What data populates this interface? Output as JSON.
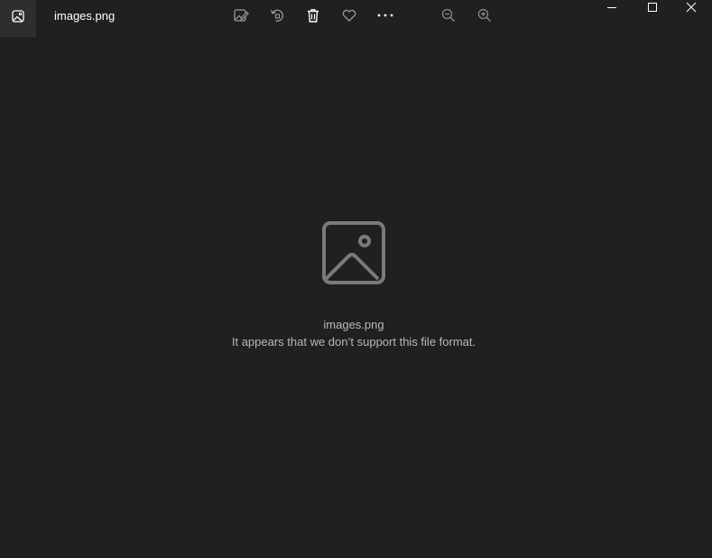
{
  "window": {
    "title": "images.png",
    "app_icon": "photo-app-icon"
  },
  "toolbar": {
    "items": [
      {
        "name": "edit-image-icon",
        "label": "Edit & Create"
      },
      {
        "name": "rotate-icon",
        "label": "Rotate"
      },
      {
        "name": "delete-icon",
        "label": "Delete"
      },
      {
        "name": "favorite-icon",
        "label": "Add to favorites"
      },
      {
        "name": "more-icon",
        "label": "See more"
      },
      {
        "name": "zoom-out-icon",
        "label": "Zoom out"
      },
      {
        "name": "zoom-in-icon",
        "label": "Zoom in"
      }
    ]
  },
  "caption_buttons": [
    "minimize-icon",
    "maximize-icon",
    "close-icon"
  ],
  "content": {
    "placeholder_icon": "image-placeholder-icon",
    "file_name": "images.png",
    "message": "It appears that we don’t support this file format."
  },
  "colors": {
    "background": "#202020",
    "text_primary": "#ffffff",
    "text_secondary": "#b8b8b8",
    "icon_muted": "#7a7a7a"
  }
}
